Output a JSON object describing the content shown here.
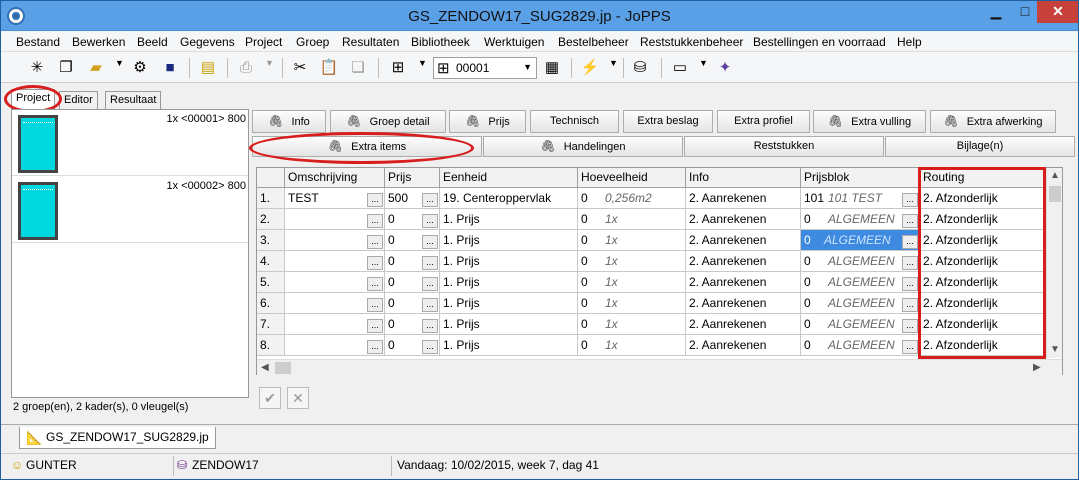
{
  "window": {
    "title": "GS_ZENDOW17_SUG2829.jp - JoPPS",
    "min": "▁",
    "max": "□",
    "close": "✕"
  },
  "menu": [
    "Bestand",
    "Bewerken",
    "Beeld",
    "Gegevens",
    "Project",
    "Groep",
    "Resultaten",
    "Bibliotheek",
    "Werktuigen",
    "Bestelbeheer",
    "Reststukkenbeheer",
    "Bestellingen en voorraad",
    "Help"
  ],
  "toolbar": {
    "combo_value": "00001"
  },
  "left_tabs": [
    "Project",
    "Editor",
    "Resultaat"
  ],
  "left_items": [
    {
      "text": "1x <00001> 800"
    },
    {
      "text": "1x <00002> 800"
    }
  ],
  "left_status": "2 groep(en), 2 kader(s), 0 vleugel(s)",
  "buttons_row1": [
    "Info",
    "Groep detail",
    "Prijs",
    "Technisch",
    "Extra beslag",
    "Extra profiel",
    "Extra vulling",
    "Extra afwerking"
  ],
  "buttons_row2": [
    "Extra items",
    "Handelingen",
    "Reststukken",
    "Bijlage(n)"
  ],
  "grid": {
    "headers": [
      "Omschrijving",
      "Prijs",
      "Eenheid",
      "Hoeveelheid",
      "Info",
      "Prijsblok",
      "Routing"
    ],
    "rows": [
      {
        "n": "1.",
        "omschrijving": "TEST",
        "prijs": "500",
        "eenheid": "19. Centeroppervlak",
        "hoev": "0",
        "hoev2": "0,256m2",
        "info": "2. Aanrekenen",
        "pb": "101",
        "pb2": "101 TEST",
        "routing": "2. Afzonderlijk"
      },
      {
        "n": "2.",
        "omschrijving": "",
        "prijs": "0",
        "eenheid": "1. Prijs",
        "hoev": "0",
        "hoev2": "1x",
        "info": "2. Aanrekenen",
        "pb": "0",
        "pb2": "ALGEMEEN",
        "routing": "2. Afzonderlijk"
      },
      {
        "n": "3.",
        "omschrijving": "",
        "prijs": "0",
        "eenheid": "1. Prijs",
        "hoev": "0",
        "hoev2": "1x",
        "info": "2. Aanrekenen",
        "pb": "0",
        "pb2": "ALGEMEEN",
        "routing": "2. Afzonderlijk"
      },
      {
        "n": "4.",
        "omschrijving": "",
        "prijs": "0",
        "eenheid": "1. Prijs",
        "hoev": "0",
        "hoev2": "1x",
        "info": "2. Aanrekenen",
        "pb": "0",
        "pb2": "ALGEMEEN",
        "routing": "2. Afzonderlijk"
      },
      {
        "n": "5.",
        "omschrijving": "",
        "prijs": "0",
        "eenheid": "1. Prijs",
        "hoev": "0",
        "hoev2": "1x",
        "info": "2. Aanrekenen",
        "pb": "0",
        "pb2": "ALGEMEEN",
        "routing": "2. Afzonderlijk"
      },
      {
        "n": "6.",
        "omschrijving": "",
        "prijs": "0",
        "eenheid": "1. Prijs",
        "hoev": "0",
        "hoev2": "1x",
        "info": "2. Aanrekenen",
        "pb": "0",
        "pb2": "ALGEMEEN",
        "routing": "2. Afzonderlijk"
      },
      {
        "n": "7.",
        "omschrijving": "",
        "prijs": "0",
        "eenheid": "1. Prijs",
        "hoev": "0",
        "hoev2": "1x",
        "info": "2. Aanrekenen",
        "pb": "0",
        "pb2": "ALGEMEEN",
        "routing": "2. Afzonderlijk"
      },
      {
        "n": "8.",
        "omschrijving": "",
        "prijs": "0",
        "eenheid": "1. Prijs",
        "hoev": "0",
        "hoev2": "1x",
        "info": "2. Aanrekenen",
        "pb": "0",
        "pb2": "ALGEMEEN",
        "routing": "2. Afzonderlijk"
      }
    ]
  },
  "doc_tab": "GS_ZENDOW17_SUG2829.jp",
  "status": {
    "user": "GUNTER",
    "db": "ZENDOW17",
    "date": "Vandaag: 10/02/2015, week 7, dag 41"
  },
  "colors": {
    "annotation": "#d81d1d",
    "selection": "#3d8ae0",
    "thumb": "#00d8e0"
  }
}
